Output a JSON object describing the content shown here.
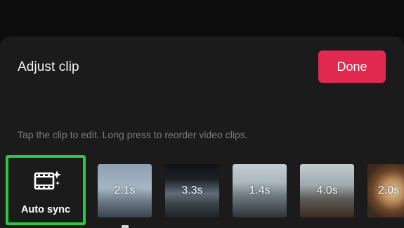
{
  "sheet": {
    "title": "Adjust clip",
    "done_label": "Done"
  },
  "hint": "Tap the clip to edit. Long press to reorder video clips.",
  "auto_sync": {
    "label": "Auto sync",
    "icon": "film-sparkle-icon"
  },
  "clips": [
    {
      "duration": "2.1s"
    },
    {
      "duration": "3.3s"
    },
    {
      "duration": "1.4s"
    },
    {
      "duration": "4.0s"
    },
    {
      "duration": "2.0s"
    }
  ],
  "colors": {
    "accent": "#e2294f",
    "highlight": "#27c93f",
    "sheet_bg": "#1b1b1b"
  }
}
